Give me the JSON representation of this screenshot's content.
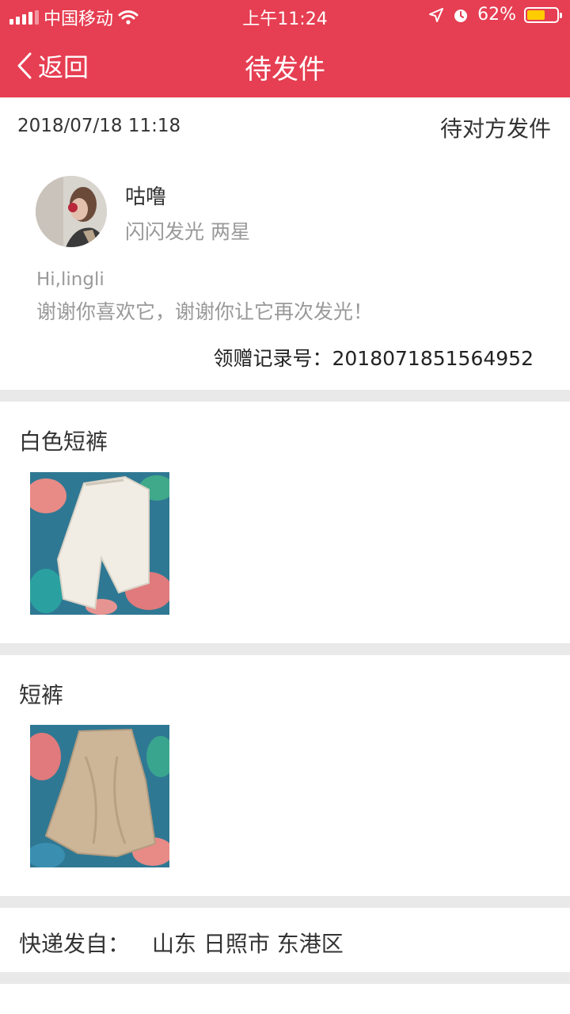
{
  "status_bar": {
    "carrier": "中国移动",
    "time": "上午11:24",
    "battery_text": "62%",
    "battery_level": 0.62
  },
  "nav": {
    "back_label": "返回",
    "title": "待发件"
  },
  "order": {
    "datetime": "2018/07/18  11:18",
    "status": "待对方发件",
    "user_name": "咕噜",
    "user_level": "闪闪发光 两星",
    "message_line1": "Hi,lingli",
    "message_line2": "谢谢你喜欢它，谢谢你让它再次发光！",
    "record_label": "领赠记录号：",
    "record_number": "2018071851564952"
  },
  "items": [
    {
      "title": "白色短裤"
    },
    {
      "title": "短裤"
    }
  ],
  "shipping": {
    "label": "快递发自：",
    "origin": "山东 日照市 东港区"
  },
  "colors": {
    "brand_red": "#e63e52",
    "divider": "#e9e9e9",
    "battery_fill": "#ffcc00"
  }
}
